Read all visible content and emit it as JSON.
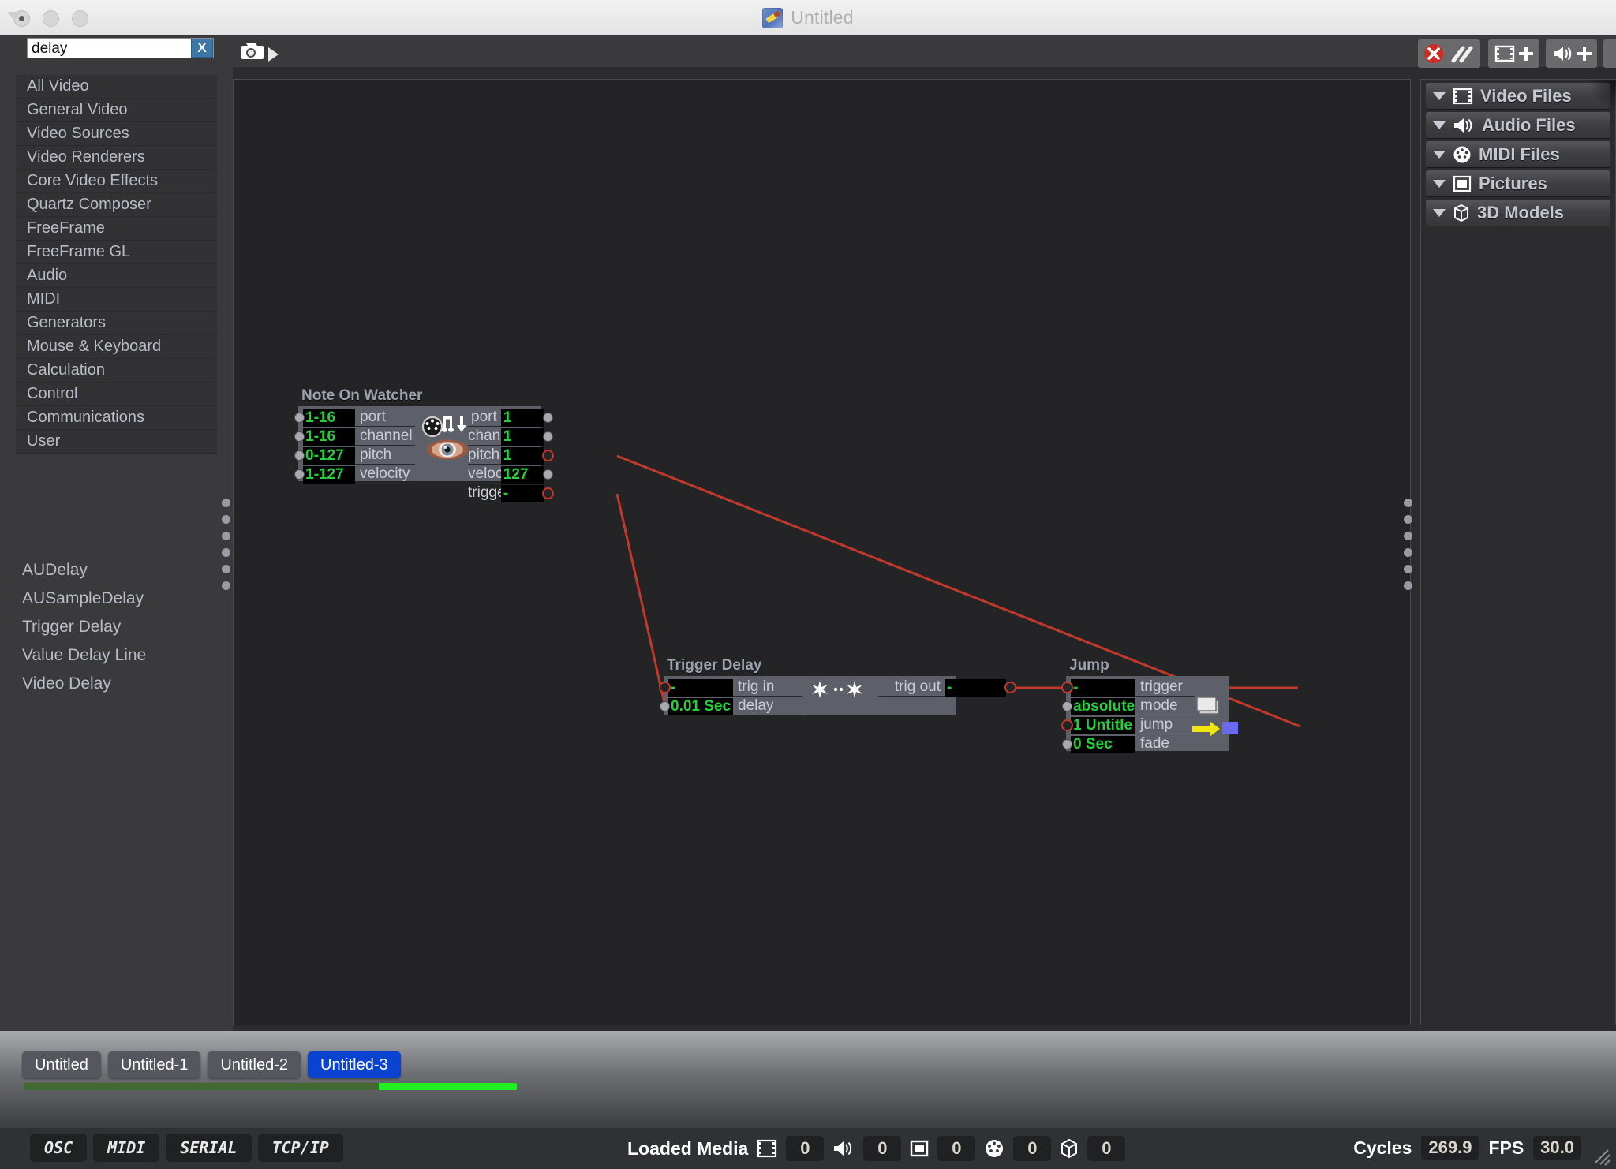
{
  "window": {
    "title": "Untitled",
    "icon": "app-icon"
  },
  "toolbar": {
    "search_value": "delay",
    "search_placeholder": "",
    "clear_label": "X",
    "snapshot_icon": "camera-icon",
    "play_icon": "play-triangle-icon",
    "buttons": [
      {
        "name": "disable-output",
        "icon": "red-x-with-slash-icon"
      },
      {
        "name": "add-video-file",
        "icon": "film-frame-plus-icon"
      },
      {
        "name": "add-audio-file",
        "icon": "speaker-plus-icon"
      },
      {
        "name": "add-picture-file",
        "icon": "picture-plus-icon"
      }
    ]
  },
  "sidebar": {
    "categories": [
      "All Video",
      "General Video",
      "Video Sources",
      "Video Renderers",
      "Core Video Effects",
      "Quartz Composer",
      "FreeFrame",
      "FreeFrame GL",
      "Audio",
      "MIDI",
      "Generators",
      "Mouse & Keyboard",
      "Calculation",
      "Control",
      "Communications",
      "User"
    ],
    "results": [
      "AUDelay",
      "AUSampleDelay",
      "Trigger Delay",
      "Value Delay Line",
      "Video Delay"
    ]
  },
  "right_panel": {
    "items": [
      {
        "label": "Video Files",
        "icon": "film-frame-icon"
      },
      {
        "label": "Audio Files",
        "icon": "speaker-icon"
      },
      {
        "label": "MIDI Files",
        "icon": "midi-connector-icon"
      },
      {
        "label": "Pictures",
        "icon": "picture-icon"
      },
      {
        "label": "3D Models",
        "icon": "cube-icon"
      }
    ]
  },
  "canvas": {
    "nodes": [
      {
        "id": "note-on-watcher",
        "title": "Note On Watcher",
        "icons": [
          "midi-connector-icon",
          "note-down-arrow-icon",
          "eye-icon"
        ],
        "inputs": [
          {
            "label": "port",
            "value": "1-16",
            "connected": false
          },
          {
            "label": "channel",
            "value": "1-16",
            "connected": false
          },
          {
            "label": "pitch",
            "value": "0-127",
            "connected": false
          },
          {
            "label": "velocity",
            "value": "1-127",
            "connected": false
          }
        ],
        "outputs": [
          {
            "label": "port",
            "value": "1",
            "connected": false
          },
          {
            "label": "channel",
            "value": "1",
            "connected": false
          },
          {
            "label": "pitch",
            "value": "1",
            "connected": true
          },
          {
            "label": "velocity",
            "value": "127",
            "connected": false
          },
          {
            "label": "trigger",
            "value": "-",
            "connected": true
          }
        ]
      },
      {
        "id": "trigger-delay",
        "title": "Trigger Delay",
        "icons": [
          "sparkle-icon",
          "dots-icon",
          "sparkle-icon"
        ],
        "inputs": [
          {
            "label": "trig in",
            "value": "-",
            "connected": true
          },
          {
            "label": "delay",
            "value": "0.01 Sec",
            "connected": false
          }
        ],
        "outputs": [
          {
            "label": "trig out",
            "value": "-",
            "connected": true
          }
        ]
      },
      {
        "id": "jump",
        "title": "Jump",
        "icons": [
          "scenes-stack-icon",
          "yellow-arrow-icon",
          "blue-scene-icon"
        ],
        "inputs": [
          {
            "label": "trigger",
            "value": "-",
            "connected": true
          },
          {
            "label": "mode",
            "value": "absolute",
            "connected": false
          },
          {
            "label": "jump",
            "value": "1 Untitle",
            "connected": true
          },
          {
            "label": "fade",
            "value": "0 Sec",
            "connected": false
          }
        ],
        "outputs": []
      }
    ],
    "cable_color": "#c0392b"
  },
  "bottom": {
    "tabs": [
      {
        "label": "Untitled",
        "active": false
      },
      {
        "label": "Untitled-1",
        "active": false
      },
      {
        "label": "Untitled-2",
        "active": false
      },
      {
        "label": "Untitled-3",
        "active": true
      }
    ],
    "protocols": [
      "OSC",
      "MIDI",
      "SERIAL",
      "TCP/IP"
    ],
    "loaded_media_label": "Loaded Media",
    "loaded_media": [
      {
        "icon": "film-frame-icon",
        "count": "0"
      },
      {
        "icon": "speaker-icon",
        "count": "0"
      },
      {
        "icon": "picture-icon",
        "count": "0"
      },
      {
        "icon": "midi-connector-icon",
        "count": "0"
      },
      {
        "icon": "cube-icon",
        "count": "0"
      }
    ],
    "cycles_label": "Cycles",
    "cycles_value": "269.9",
    "fps_label": "FPS",
    "fps_value": "30.0"
  },
  "colors": {
    "accent_blue": "#0a43cf",
    "value_green": "#23d23b",
    "cable_red": "#c0392b",
    "progress_green": "#22ef22"
  }
}
